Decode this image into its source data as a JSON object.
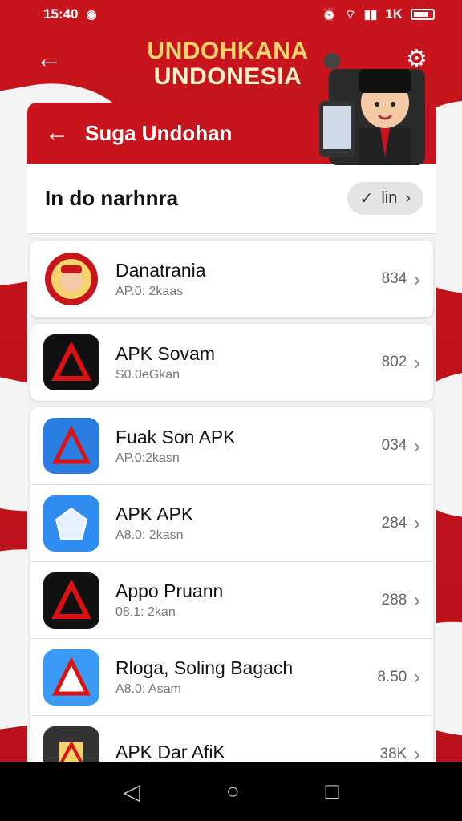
{
  "status_bar": {
    "time": "15:40",
    "right_text": "1K"
  },
  "header": {
    "brand_line1": "UNDOHKANA",
    "brand_line2": "UNDONESIA"
  },
  "card": {
    "title": "Suga Undohan",
    "filter_title": "In do narhnra",
    "filter_chip_label": "lin"
  },
  "apps": [
    {
      "name": "Danatrania",
      "sub": "AP.0: 2kaas",
      "size": "834"
    },
    {
      "name": "APK Sovam",
      "sub": "S0.0eGkan",
      "size": "802"
    },
    {
      "name": "Fuak Son APK",
      "sub": "AP.0:2kasn",
      "size": "034"
    },
    {
      "name": "APK APK",
      "sub": "A8.0: 2kasn",
      "size": "284"
    },
    {
      "name": "Appo Pruann",
      "sub": "08.1: 2kan",
      "size": "288"
    },
    {
      "name": "Rloga, Soling Bagach",
      "sub": "A8.0: Asam",
      "size": "8.50"
    },
    {
      "name": "APK Dar AfiK",
      "sub": "",
      "size": "38K"
    }
  ],
  "colors": {
    "brand_red": "#c8141d",
    "gold": "#f6d36b"
  },
  "icons": [
    "back-arrow-icon",
    "settings-icon",
    "chevron-right-icon",
    "checkmark-icon"
  ]
}
